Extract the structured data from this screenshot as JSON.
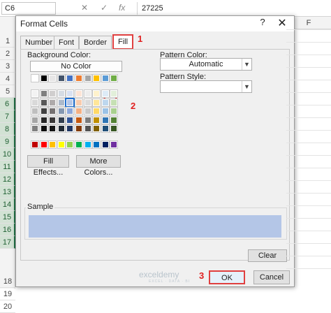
{
  "formula_bar": {
    "name_box": "C6",
    "cancel": "✕",
    "enter": "✓",
    "fx": "fx",
    "value": "27225"
  },
  "row_headers": [
    "1",
    "2",
    "3",
    "4",
    "5",
    "6",
    "7",
    "8",
    "9",
    "10",
    "11",
    "12",
    "13",
    "14",
    "15",
    "16",
    "17",
    "",
    "",
    "",
    "18",
    "19",
    "20"
  ],
  "selected_rows": [
    "6",
    "7",
    "8",
    "9",
    "10",
    "11",
    "12",
    "13",
    "14",
    "15",
    "16",
    "17"
  ],
  "column_header": "F",
  "dialog": {
    "title": "Format Cells",
    "help": "?",
    "close": "✕",
    "tabs": [
      {
        "label": "Number"
      },
      {
        "label": "Font"
      },
      {
        "label": "Border"
      },
      {
        "label": "Fill",
        "active": true
      }
    ],
    "background_color_label": "Background Color:",
    "no_color_label": "No Color",
    "pattern_color_label": "Pattern Color:",
    "pattern_color_value": "Automatic",
    "pattern_style_label": "Pattern Style:",
    "pattern_style_value": "",
    "fill_effects_label": "Fill Effects...",
    "more_colors_label": "More Colors...",
    "sample_label": "Sample",
    "sample_color": "#b4c6e7",
    "clear_label": "Clear",
    "ok_label": "OK",
    "cancel_label": "Cancel"
  },
  "palette": {
    "theme_top": [
      "#ffffff",
      "#000000",
      "#e7e6e6",
      "#44546a",
      "#4472c4",
      "#ed7d31",
      "#a5a5a5",
      "#ffc000",
      "#5b9bd5",
      "#70ad47"
    ],
    "theme_tints": [
      [
        "#f2f2f2",
        "#808080",
        "#d0cece",
        "#d6dce4",
        "#d9e1f2",
        "#fce4d6",
        "#ededed",
        "#fff2cc",
        "#ddebf7",
        "#e2efda"
      ],
      [
        "#d9d9d9",
        "#595959",
        "#aeaaaa",
        "#acb9ca",
        "#b4c6e7",
        "#f8cbad",
        "#dbdbdb",
        "#ffe699",
        "#bdd7ee",
        "#c6e0b4"
      ],
      [
        "#bfbfbf",
        "#404040",
        "#757171",
        "#8497b0",
        "#8ea9db",
        "#f4b084",
        "#c9c9c9",
        "#ffd966",
        "#9bc2e6",
        "#a9d08e"
      ],
      [
        "#a6a6a6",
        "#262626",
        "#3a3838",
        "#333f4f",
        "#305496",
        "#c65911",
        "#7b7b7b",
        "#bf8f00",
        "#2f75b5",
        "#548235"
      ],
      [
        "#808080",
        "#0d0d0d",
        "#161616",
        "#222b35",
        "#203764",
        "#833c0c",
        "#525252",
        "#806000",
        "#1f4e78",
        "#375623"
      ]
    ],
    "standard": [
      "#c00000",
      "#ff0000",
      "#ffc000",
      "#ffff00",
      "#92d050",
      "#00b050",
      "#00b0f0",
      "#0070c0",
      "#002060",
      "#7030a0"
    ],
    "selected_color": "#b4c6e7"
  },
  "annotations": {
    "fill_tab": "1",
    "swatch": "2",
    "ok_button": "3"
  },
  "watermark": {
    "name": "exceldemy",
    "tagline": "EXCEL · DATA · BI"
  }
}
